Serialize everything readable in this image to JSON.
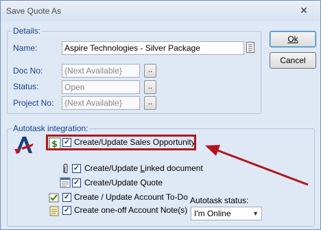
{
  "window": {
    "title": "Save Quote As",
    "close_glyph": "✕"
  },
  "buttons": {
    "ok": "Ok",
    "cancel": "Cancel"
  },
  "details": {
    "group_title": "Details:",
    "name_label": "Name:",
    "name_value": "Aspire Technologies - Silver Package",
    "doc_no_label": "Doc No:",
    "doc_no_value": "{Next Available}",
    "status_label": "Status:",
    "status_value": "Open",
    "project_no_label": "Project No:",
    "project_no_value": "{Next Available}",
    "browse_label": ".."
  },
  "autotask": {
    "group_title": "Autotask integration:",
    "checkbox_glyph": "✓",
    "options": [
      {
        "label": "Create/Update Sales Opportunity.",
        "checked": true,
        "icon": "dollar-icon"
      },
      {
        "label": "Create/Update Linked document",
        "checked": true,
        "icon": "paperclip-icon"
      },
      {
        "label": "Create/Update Quote",
        "checked": true,
        "icon": "quote-document-icon"
      },
      {
        "label": "Create / Update Account To-Do",
        "checked": true,
        "icon": "todo-icon"
      },
      {
        "label": "Create one-off Account Note(s)",
        "checked": true,
        "icon": "note-icon"
      }
    ],
    "status_label": "Autotask status:",
    "status_value": "I'm Online"
  },
  "colors": {
    "highlight": "#b0161c",
    "group_title": "#15428b",
    "dialog_bg": "#dfe8f5"
  }
}
